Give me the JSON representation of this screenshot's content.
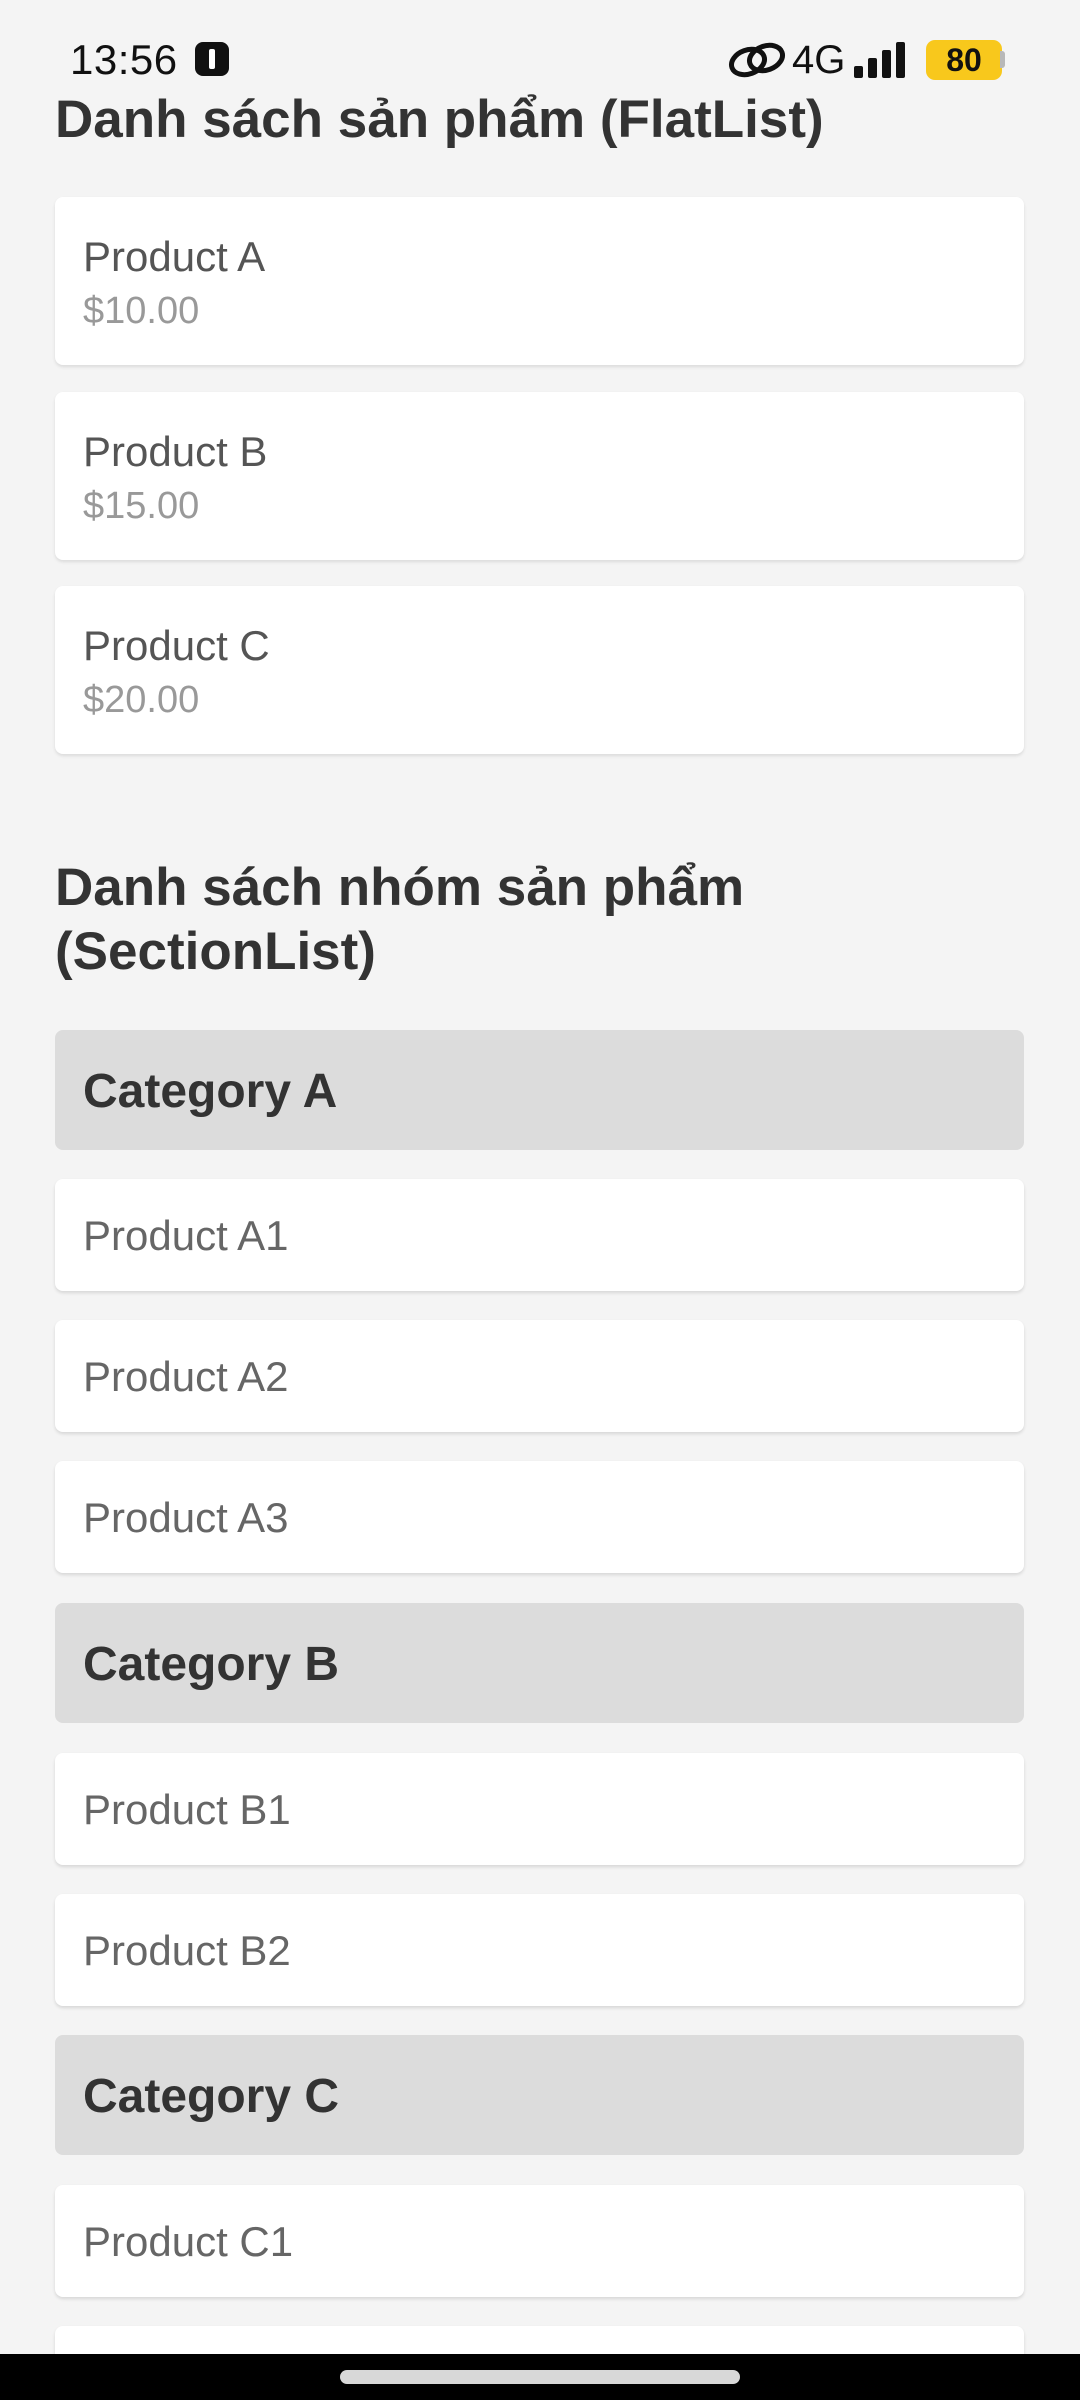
{
  "status_bar": {
    "time": "13:56",
    "network": "4G",
    "battery": "80",
    "notification_icon": "alert-badge-icon",
    "link_icon": "link-icon",
    "signal_icon": "signal-bars-icon"
  },
  "flatlist": {
    "title": "Danh sách sản phẩm (FlatList)",
    "items": [
      {
        "name": "Product A",
        "price": "$10.00"
      },
      {
        "name": "Product B",
        "price": "$15.00"
      },
      {
        "name": "Product C",
        "price": "$20.00"
      }
    ]
  },
  "sectionlist": {
    "title": "Danh sách nhóm sản phẩm (SectionList)",
    "sections": [
      {
        "title": "Category A",
        "items": [
          "Product A1",
          "Product A2",
          "Product A3"
        ]
      },
      {
        "title": "Category B",
        "items": [
          "Product B1",
          "Product B2"
        ]
      },
      {
        "title": "Category C",
        "items": [
          "Product C1",
          ""
        ]
      }
    ]
  },
  "colors": {
    "background": "#f4f4f4",
    "card": "#ffffff",
    "category_header": "#dcdcdc",
    "battery": "#f8c81c"
  }
}
